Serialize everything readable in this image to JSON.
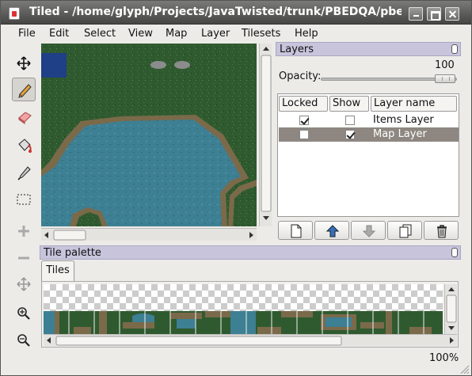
{
  "window": {
    "title": "Tiled - /home/glyph/Projects/JavaTwisted/trunk/PBEDQA/pbedqa/dat"
  },
  "menubar": {
    "items": [
      "File",
      "Edit",
      "Select",
      "View",
      "Map",
      "Layer",
      "Tilesets",
      "Help"
    ]
  },
  "toolbar": {
    "tools": [
      "move-icon",
      "pencil-icon",
      "eraser-icon",
      "bucket-fill-icon",
      "eyedropper-icon",
      "rect-select-icon",
      "zoom-in-plus-icon",
      "zoom-out-minus-icon",
      "pan-icon",
      "magnify-in-icon",
      "magnify-out-icon"
    ]
  },
  "layers_panel": {
    "title": "Layers",
    "opacity_label": "Opacity:",
    "opacity_value": "100",
    "opacity_level": 1.0,
    "columns": [
      "Locked",
      "Show",
      "Layer name"
    ],
    "rows": [
      {
        "name": "Items Layer",
        "locked": true,
        "show": false,
        "selected": false
      },
      {
        "name": "Map Layer",
        "locked": false,
        "show": true,
        "selected": true
      }
    ],
    "buttons": [
      "new-layer-icon",
      "move-layer-up-icon",
      "move-layer-down-icon",
      "duplicate-layer-icon",
      "delete-layer-icon"
    ]
  },
  "tile_palette": {
    "title": "Tile palette",
    "tabs": [
      "Tiles"
    ]
  },
  "status": {
    "zoom": "100%"
  },
  "colors": {
    "dock_header": "#c7c4dc",
    "selected_row": "#8e8781",
    "grass": "#2f5a2f",
    "water": "#3d7f93",
    "shore": "#7a6a4a"
  }
}
